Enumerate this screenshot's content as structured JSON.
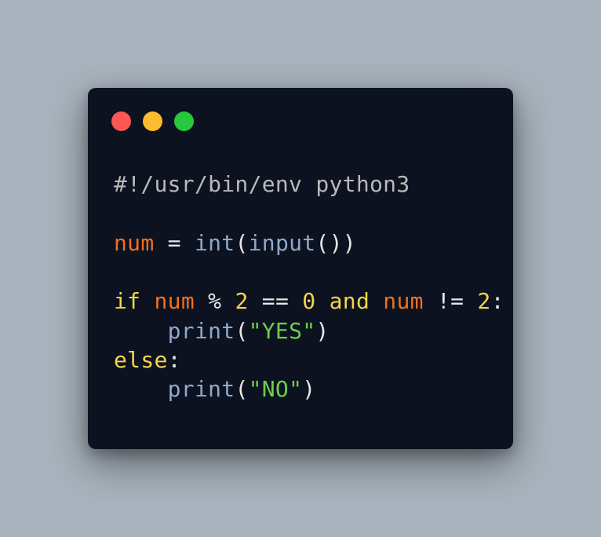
{
  "window": {
    "controls": [
      {
        "name": "close",
        "color": "#fc5753"
      },
      {
        "name": "minimize",
        "color": "#fdbc2e"
      },
      {
        "name": "maximize",
        "color": "#27c840"
      }
    ]
  },
  "colors": {
    "comment": "#b9b9b9",
    "variable": "#f0711c",
    "keyword": "#f5d547",
    "builtin": "#8fa8cc",
    "string": "#6ccf4a",
    "number": "#f5d547",
    "plain": "#e6e6e6"
  },
  "code": {
    "language": "python",
    "lines": [
      [
        {
          "t": "#!/usr/bin/env python3",
          "k": "comment"
        }
      ],
      [],
      [
        {
          "t": "num",
          "k": "variable"
        },
        {
          "t": " = ",
          "k": "plain"
        },
        {
          "t": "int",
          "k": "builtin"
        },
        {
          "t": "(",
          "k": "plain"
        },
        {
          "t": "input",
          "k": "builtin"
        },
        {
          "t": "())",
          "k": "plain"
        }
      ],
      [],
      [
        {
          "t": "if",
          "k": "keyword"
        },
        {
          "t": " ",
          "k": "plain"
        },
        {
          "t": "num",
          "k": "variable"
        },
        {
          "t": " % ",
          "k": "plain"
        },
        {
          "t": "2",
          "k": "number"
        },
        {
          "t": " == ",
          "k": "plain"
        },
        {
          "t": "0",
          "k": "number"
        },
        {
          "t": " ",
          "k": "plain"
        },
        {
          "t": "and",
          "k": "keyword"
        },
        {
          "t": " ",
          "k": "plain"
        },
        {
          "t": "num",
          "k": "variable"
        },
        {
          "t": " != ",
          "k": "plain"
        },
        {
          "t": "2",
          "k": "number"
        },
        {
          "t": ":",
          "k": "plain"
        }
      ],
      [
        {
          "t": "    ",
          "k": "plain"
        },
        {
          "t": "print",
          "k": "builtin"
        },
        {
          "t": "(",
          "k": "plain"
        },
        {
          "t": "\"YES\"",
          "k": "string"
        },
        {
          "t": ")",
          "k": "plain"
        }
      ],
      [
        {
          "t": "else",
          "k": "keyword"
        },
        {
          "t": ":",
          "k": "plain"
        }
      ],
      [
        {
          "t": "    ",
          "k": "plain"
        },
        {
          "t": "print",
          "k": "builtin"
        },
        {
          "t": "(",
          "k": "plain"
        },
        {
          "t": "\"NO\"",
          "k": "string"
        },
        {
          "t": ")",
          "k": "plain"
        }
      ]
    ]
  }
}
